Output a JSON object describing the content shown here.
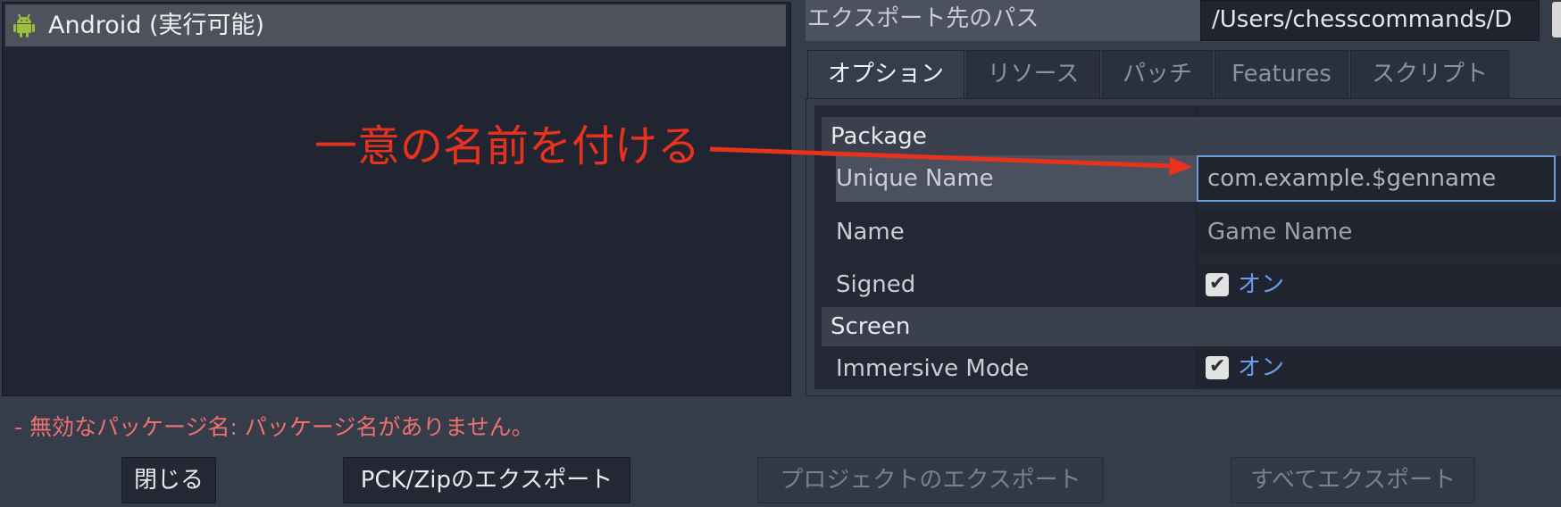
{
  "preset_list": {
    "items": [
      {
        "label": "Android (実行可能)",
        "icon": "android-icon"
      }
    ]
  },
  "export_path": {
    "label": "エクスポート先のパス",
    "value": "/Users/chesscommands/D"
  },
  "tabs": [
    {
      "label": "オプション",
      "active": true
    },
    {
      "label": "リソース",
      "active": false
    },
    {
      "label": "パッチ",
      "active": false
    },
    {
      "label": "Features",
      "active": false
    },
    {
      "label": "スクリプト",
      "active": false
    }
  ],
  "options": {
    "sections": [
      {
        "label": "Package",
        "properties": [
          {
            "name": "Unique Name",
            "value": "com.example.$genname",
            "highlighted": true
          },
          {
            "name": "Name",
            "value": "Game Name"
          },
          {
            "name": "Signed",
            "checked": true,
            "value": "オン"
          }
        ]
      },
      {
        "label": "Screen",
        "properties": [
          {
            "name": "Immersive Mode",
            "checked": true,
            "value": "オン"
          }
        ]
      }
    ]
  },
  "annotation": {
    "text": "一意の名前を付ける",
    "color": "#e8321e"
  },
  "error": {
    "text": "- 無効なパッケージ名: パッケージ名がありません。"
  },
  "buttons": {
    "close": "閉じる",
    "export_pck": "PCK/Zipのエクスポート",
    "export_project": "プロジェクトのエクスポート",
    "export_all": "すべてエクスポート"
  },
  "colors": {
    "background": "#363d4a",
    "panel": "#202531",
    "accent": "#6a9fdd",
    "error": "#ee7070",
    "check_label": "#6d9bf0"
  }
}
